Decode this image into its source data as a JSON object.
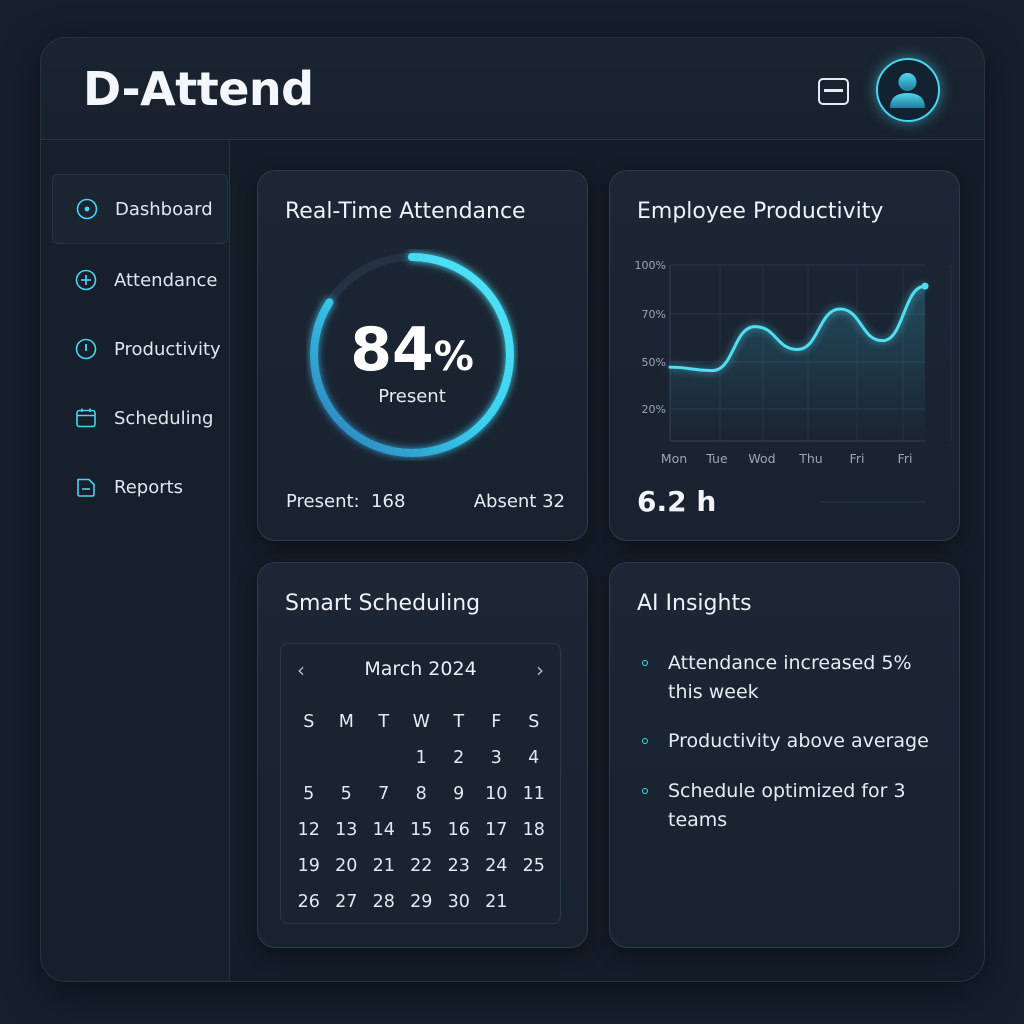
{
  "app": {
    "title": "D-Attend"
  },
  "header": {
    "menu_icon": "menu-icon",
    "avatar_icon": "user-avatar-icon"
  },
  "sidebar": {
    "items": [
      {
        "label": "Dashboard",
        "icon": "target-icon",
        "active": true
      },
      {
        "label": "Attendance",
        "icon": "plus-circle-icon"
      },
      {
        "label": "Productivity",
        "icon": "info-circle-icon"
      },
      {
        "label": "Scheduling",
        "icon": "calendar-icon"
      },
      {
        "label": "Reports",
        "icon": "document-icon"
      }
    ]
  },
  "attendance": {
    "title": "Real-Time Attendance",
    "percent_number": "84",
    "percent_sign": "%",
    "percent_value": 84,
    "status_label": "Present",
    "present_text": "Present:  168",
    "absent_text": "Absent 32"
  },
  "productivity": {
    "title": "Employee Productivity",
    "hours": "6.2 h"
  },
  "chart_data": {
    "type": "line",
    "title": "Employee Productivity",
    "x": [
      "Mon",
      "Tue",
      "Wod",
      "Thu",
      "Fri",
      "Fri"
    ],
    "y_ticks": [
      "100%",
      "70%",
      "50%",
      "20%"
    ],
    "ylim": [
      0,
      100
    ],
    "series": [
      {
        "values": [
          42,
          40,
          65,
          52,
          75,
          57,
          88
        ]
      }
    ],
    "grid": true,
    "legend": "none",
    "line_color": "#4fdff3"
  },
  "scheduling": {
    "title": "Smart Scheduling",
    "month": "March 2024",
    "prev_icon": "chevron-left-icon",
    "next_icon": "chevron-right-icon",
    "weekdays": [
      "S",
      "M",
      "T",
      "W",
      "T",
      "F",
      "S"
    ],
    "weeks": [
      [
        "",
        "",
        "",
        "1",
        "2",
        "3",
        "4"
      ],
      [
        "5",
        "5",
        "7",
        "8",
        "9",
        "10",
        "11"
      ],
      [
        "12",
        "13",
        "14",
        "15",
        "16",
        "17",
        "18"
      ],
      [
        "19",
        "20",
        "21",
        "22",
        "23",
        "24",
        "25"
      ],
      [
        "26",
        "27",
        "28",
        "29",
        "30",
        "21",
        ""
      ]
    ]
  },
  "insights": {
    "title": "AI Insights",
    "items": [
      "Attendance increased 5% this week",
      "Productivity above average",
      "Schedule optimized for 3 teams"
    ]
  },
  "colors": {
    "accent": "#47d6ee",
    "background": "#161f2c",
    "card": "#1c2634"
  }
}
